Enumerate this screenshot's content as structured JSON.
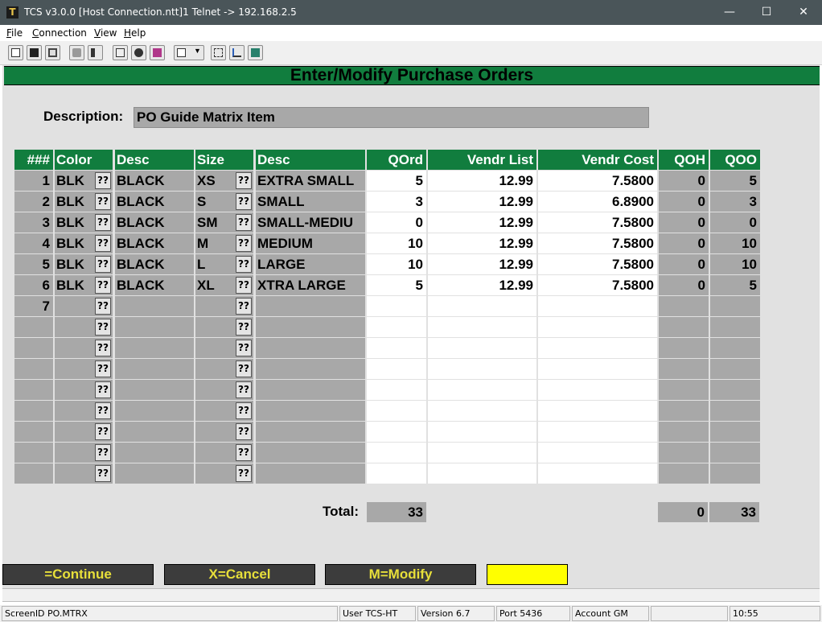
{
  "window": {
    "app_icon": "T",
    "title": "TCS v3.0.0 [Host Connection.ntt]1 Telnet -> 192.168.2.5",
    "controls": [
      "minimize-icon",
      "maximize-icon",
      "close-icon"
    ]
  },
  "menu": [
    {
      "label": "File",
      "key": "F",
      "rest": "ile"
    },
    {
      "label": "Connection",
      "key": "C",
      "rest": "onnection"
    },
    {
      "label": "View",
      "key": "V",
      "rest": "iew"
    },
    {
      "label": "Help",
      "key": "H",
      "rest": "elp"
    }
  ],
  "toolbar_icons": [
    "copy-icon",
    "save-icon",
    "print-icon",
    "lock-icon",
    "sound-icon",
    "properties-icon",
    "monitor-icon",
    "book-icon",
    "dropdown-icon",
    "transfer-icon",
    "chart-icon",
    "calculator-icon"
  ],
  "screen": {
    "title": "Enter/Modify Purchase Orders",
    "description": {
      "label": "Description:",
      "value": "PO Guide Matrix Item"
    },
    "columns": [
      "###",
      "Color",
      "Desc",
      "Size",
      "Desc",
      "QOrd",
      "Vendr List",
      "Vendr Cost",
      "QOH",
      "QOO"
    ],
    "lookup_label": "??",
    "rows": [
      {
        "num": "1",
        "color": "BLK",
        "color_desc": "BLACK",
        "size": "XS",
        "size_desc": "EXTRA SMALL",
        "qord": "5",
        "vlist": "12.99",
        "vcost": "7.5800",
        "qoh": "0",
        "qoo": "5"
      },
      {
        "num": "2",
        "color": "BLK",
        "color_desc": "BLACK",
        "size": "S",
        "size_desc": "SMALL",
        "qord": "3",
        "vlist": "12.99",
        "vcost": "6.8900",
        "qoh": "0",
        "qoo": "3"
      },
      {
        "num": "3",
        "color": "BLK",
        "color_desc": "BLACK",
        "size": "SM",
        "size_desc": "SMALL-MEDIU",
        "qord": "0",
        "vlist": "12.99",
        "vcost": "7.5800",
        "qoh": "0",
        "qoo": "0"
      },
      {
        "num": "4",
        "color": "BLK",
        "color_desc": "BLACK",
        "size": "M",
        "size_desc": "MEDIUM",
        "qord": "10",
        "vlist": "12.99",
        "vcost": "7.5800",
        "qoh": "0",
        "qoo": "10"
      },
      {
        "num": "5",
        "color": "BLK",
        "color_desc": "BLACK",
        "size": "L",
        "size_desc": "LARGE",
        "qord": "10",
        "vlist": "12.99",
        "vcost": "7.5800",
        "qoh": "0",
        "qoo": "10"
      },
      {
        "num": "6",
        "color": "BLK",
        "color_desc": "BLACK",
        "size": "XL",
        "size_desc": "XTRA LARGE",
        "qord": "5",
        "vlist": "12.99",
        "vcost": "7.5800",
        "qoh": "0",
        "qoo": "5"
      },
      {
        "num": "7",
        "color": "",
        "color_desc": "",
        "size": "",
        "size_desc": "",
        "qord": "",
        "vlist": "",
        "vcost": "",
        "qoh": "",
        "qoo": ""
      },
      {
        "num": "",
        "color": "",
        "color_desc": "",
        "size": "",
        "size_desc": "",
        "qord": "",
        "vlist": "",
        "vcost": "",
        "qoh": "",
        "qoo": ""
      },
      {
        "num": "",
        "color": "",
        "color_desc": "",
        "size": "",
        "size_desc": "",
        "qord": "",
        "vlist": "",
        "vcost": "",
        "qoh": "",
        "qoo": ""
      },
      {
        "num": "",
        "color": "",
        "color_desc": "",
        "size": "",
        "size_desc": "",
        "qord": "",
        "vlist": "",
        "vcost": "",
        "qoh": "",
        "qoo": ""
      },
      {
        "num": "",
        "color": "",
        "color_desc": "",
        "size": "",
        "size_desc": "",
        "qord": "",
        "vlist": "",
        "vcost": "",
        "qoh": "",
        "qoo": ""
      },
      {
        "num": "",
        "color": "",
        "color_desc": "",
        "size": "",
        "size_desc": "",
        "qord": "",
        "vlist": "",
        "vcost": "",
        "qoh": "",
        "qoo": ""
      },
      {
        "num": "",
        "color": "",
        "color_desc": "",
        "size": "",
        "size_desc": "",
        "qord": "",
        "vlist": "",
        "vcost": "",
        "qoh": "",
        "qoo": ""
      },
      {
        "num": "",
        "color": "",
        "color_desc": "",
        "size": "",
        "size_desc": "",
        "qord": "",
        "vlist": "",
        "vcost": "",
        "qoh": "",
        "qoo": ""
      },
      {
        "num": "",
        "color": "",
        "color_desc": "",
        "size": "",
        "size_desc": "",
        "qord": "",
        "vlist": "",
        "vcost": "",
        "qoh": "",
        "qoo": ""
      }
    ],
    "totals": {
      "label": "Total:",
      "qord": "33",
      "qoh": "0",
      "qoo": "33"
    },
    "function_keys": [
      "=Continue",
      "X=Cancel",
      "M=Modify"
    ]
  },
  "status": [
    "ScreenID PO.MTRX",
    "",
    "User TCS-HT",
    "Version 6.7",
    "Port 5436",
    "Account GM",
    "",
    "10:55"
  ],
  "colors": {
    "header_green": "#117d3e",
    "screen_gray": "#e1e1e1",
    "field_gray": "#a8a8a8",
    "fkey_text": "#e7df3a",
    "highlight_yellow": "#ffff00"
  }
}
